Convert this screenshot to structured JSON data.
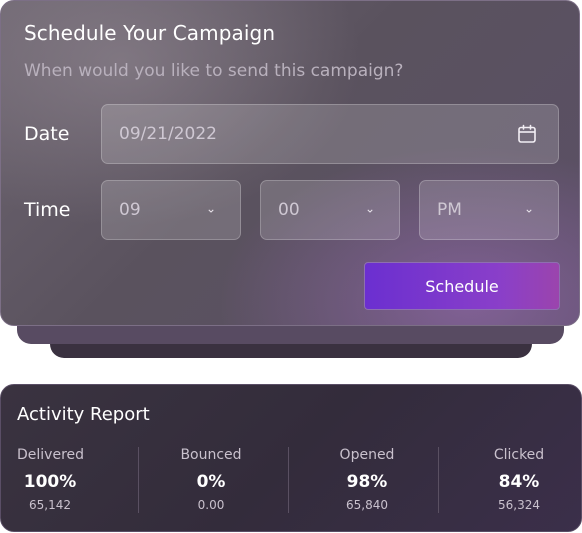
{
  "schedule": {
    "title": "Schedule Your Campaign",
    "subtitle": "When would you like to send this campaign?",
    "date_label": "Date",
    "date_value": "09/21/2022",
    "time_label": "Time",
    "hour_value": "09",
    "minute_value": "00",
    "period_value": "PM",
    "button_label": "Schedule",
    "icons": {
      "calendar": "calendar-icon",
      "chevron": "chevron-down-icon"
    }
  },
  "report": {
    "title": "Activity Report",
    "stats": [
      {
        "label": "Delivered",
        "percent": "100%",
        "count": "65,142"
      },
      {
        "label": "Bounced",
        "percent": "0%",
        "count": "0.00"
      },
      {
        "label": "Opened",
        "percent": "98%",
        "count": "65,840"
      },
      {
        "label": "Clicked",
        "percent": "84%",
        "count": "56,324"
      }
    ]
  },
  "colors": {
    "accent_start": "#6b2fd0",
    "accent_end": "#9b44ad",
    "panel_bg": "#5a525e",
    "report_bg": "#332c3b"
  }
}
